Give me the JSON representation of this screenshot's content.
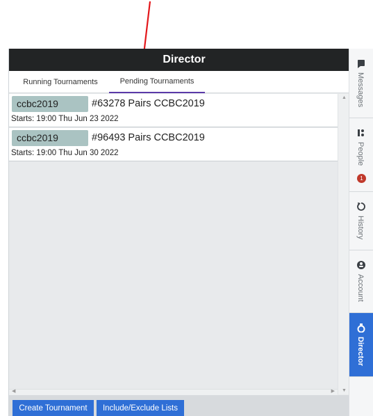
{
  "window": {
    "title": "Director"
  },
  "tabs": [
    {
      "label": "Running Tournaments"
    },
    {
      "label": "Pending Tournaments"
    }
  ],
  "tournaments": [
    {
      "code": "ccbc2019",
      "name": "#63278 Pairs CCBC2019",
      "starts": "Starts: 19:00 Thu Jun 23 2022"
    },
    {
      "code": "ccbc2019",
      "name": "#96493 Pairs CCBC2019",
      "starts": "Starts: 19:00 Thu Jun 30 2022"
    }
  ],
  "bottom_buttons": {
    "create": "Create Tournament",
    "lists": "Include/Exclude Lists"
  },
  "side_tabs": [
    {
      "label": "Messages",
      "icon": "messages-icon"
    },
    {
      "label": "People",
      "icon": "people-icon",
      "badge": "1"
    },
    {
      "label": "History",
      "icon": "history-icon"
    },
    {
      "label": "Account",
      "icon": "account-icon"
    },
    {
      "label": "Director",
      "icon": "director-icon"
    }
  ],
  "colors": {
    "accent": "#2f6fd6",
    "titlebar": "#222425",
    "code_bg": "#aac3c2",
    "annotation": "#e3171b"
  }
}
